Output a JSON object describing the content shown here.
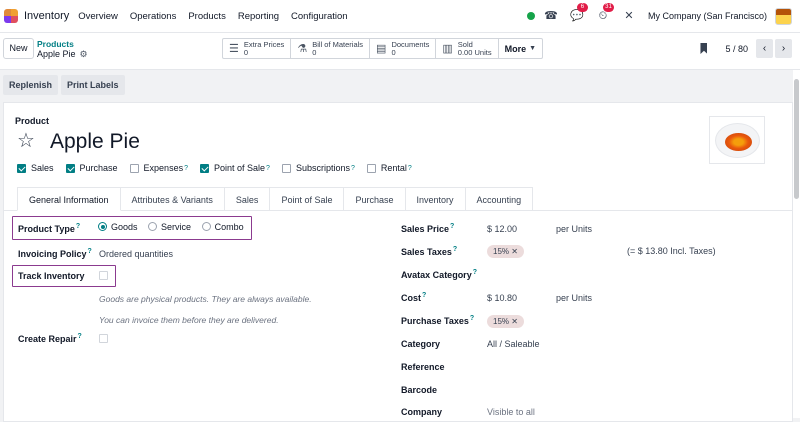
{
  "nav": {
    "app_name": "Inventory",
    "menu": [
      "Overview",
      "Operations",
      "Products",
      "Reporting",
      "Configuration"
    ],
    "chat_badge": "6",
    "activity_badge": "31",
    "company": "My Company (San Francisco)"
  },
  "control": {
    "new_label": "New",
    "breadcrumb_parent": "Products",
    "breadcrumb_current": "Apple Pie",
    "smart_buttons": [
      {
        "icon": "list-icon",
        "title": "Extra Prices",
        "value": "0"
      },
      {
        "icon": "flask-icon",
        "title": "Bill of Materials",
        "value": "0"
      },
      {
        "icon": "document-icon",
        "title": "Documents",
        "value": "0"
      },
      {
        "icon": "bar-chart-icon",
        "title": "Sold",
        "value": "0.00 Units"
      }
    ],
    "more_label": "More",
    "pager": "5 / 80"
  },
  "actions": {
    "replenish": "Replenish",
    "print_labels": "Print Labels"
  },
  "product": {
    "label": "Product",
    "name": "Apple Pie",
    "checks": [
      {
        "label": "Sales",
        "checked": true
      },
      {
        "label": "Purchase",
        "checked": true
      },
      {
        "label": "Expenses",
        "checked": false,
        "tip": "?"
      },
      {
        "label": "Point of Sale",
        "checked": true,
        "tip": "?"
      },
      {
        "label": "Subscriptions",
        "checked": false,
        "tip": "?"
      },
      {
        "label": "Rental",
        "checked": false,
        "tip": "?"
      }
    ]
  },
  "tabs": [
    "General Information",
    "Attributes & Variants",
    "Sales",
    "Point of Sale",
    "Purchase",
    "Inventory",
    "Accounting"
  ],
  "general": {
    "product_type_label": "Product Type",
    "product_type_options": [
      "Goods",
      "Service",
      "Combo"
    ],
    "product_type_selected": "Goods",
    "invoicing_policy_label": "Invoicing Policy",
    "invoicing_policy_value": "Ordered quantities",
    "track_inventory_label": "Track Inventory",
    "hint_goods": "Goods are physical products. They are always available.",
    "hint_invoice": "You can invoice them before they are delivered.",
    "create_repair_label": "Create Repair",
    "tip": "?"
  },
  "right": {
    "sales_price_label": "Sales Price",
    "sales_price_value": "$ 12.00",
    "sales_price_unit": "per Units",
    "sales_taxes_label": "Sales Taxes",
    "sales_taxes_tag": "15%",
    "sales_taxes_incl": "(= $ 13.80 Incl. Taxes)",
    "avatax_label": "Avatax Category",
    "cost_label": "Cost",
    "cost_value": "$ 10.80",
    "cost_unit": "per Units",
    "purchase_taxes_label": "Purchase Taxes",
    "purchase_taxes_tag": "15%",
    "category_label": "Category",
    "category_value": "All / Saleable",
    "reference_label": "Reference",
    "barcode_label": "Barcode",
    "company_label": "Company",
    "company_value": "Visible to all"
  }
}
